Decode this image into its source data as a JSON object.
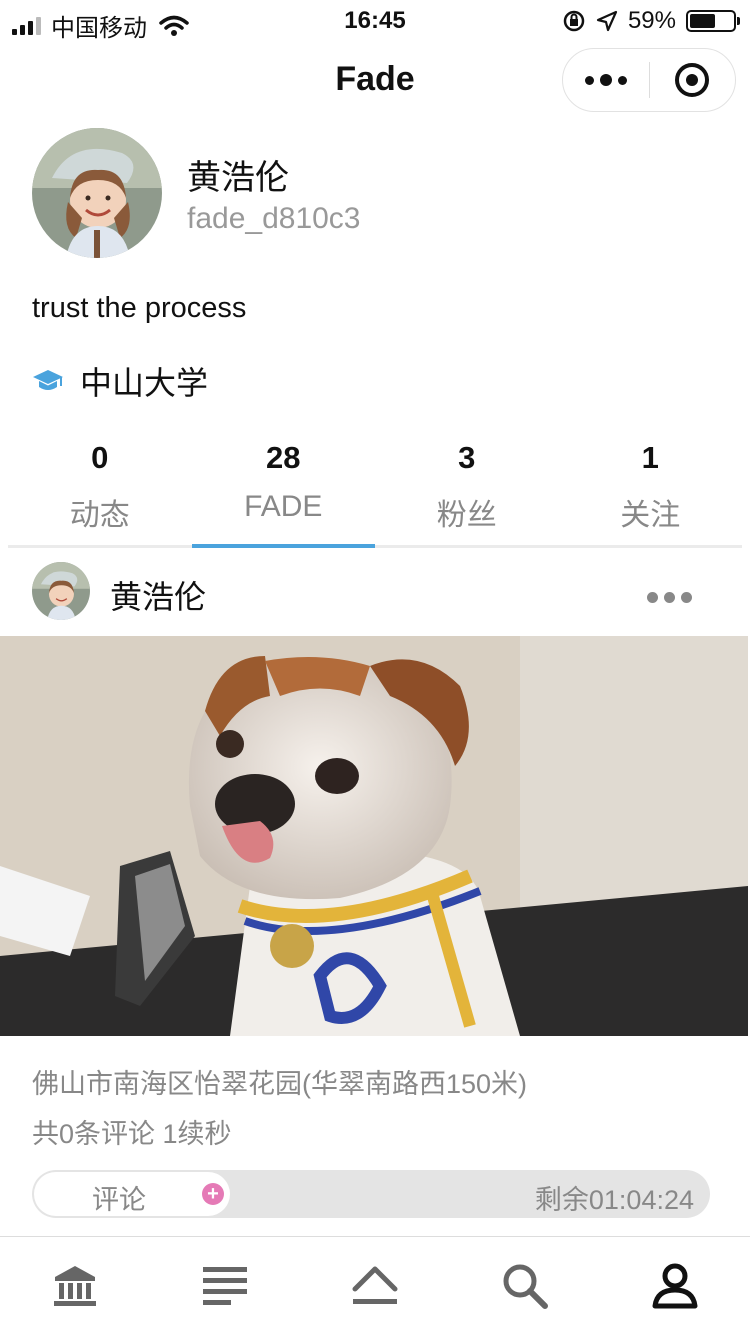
{
  "status_bar": {
    "carrier": "中国移动",
    "time": "16:45",
    "battery_text": "59%",
    "battery_level": 0.59,
    "icons": [
      "signal-icon",
      "wifi-icon",
      "orientation-lock-icon",
      "location-arrow-icon",
      "battery-icon"
    ]
  },
  "nav": {
    "title": "Fade",
    "more_icon": "more-dots-icon",
    "close_icon": "target-icon"
  },
  "profile": {
    "name": "黄浩伦",
    "handle": "fade_d810c3",
    "bio": "trust the process",
    "school": "中山大学",
    "school_icon": "graduation-cap-icon",
    "school_icon_color": "#4aa3dd"
  },
  "stats": [
    {
      "count": "0",
      "label": "动态"
    },
    {
      "count": "28",
      "label": "FADE"
    },
    {
      "count": "3",
      "label": "粉丝"
    },
    {
      "count": "1",
      "label": "关注"
    }
  ],
  "active_tab_color": "#4aa3dd",
  "post": {
    "author": "黄浩伦",
    "location": "佛山市南海区怡翠花园(华翠南路西150米)",
    "meta": "共0条评论 1续秒",
    "comment_label": "评论",
    "remaining": "剩余01:04:24"
  },
  "tabbar": [
    "bank-icon",
    "list-icon",
    "up-chevron-icon",
    "search-icon",
    "profile-icon"
  ]
}
